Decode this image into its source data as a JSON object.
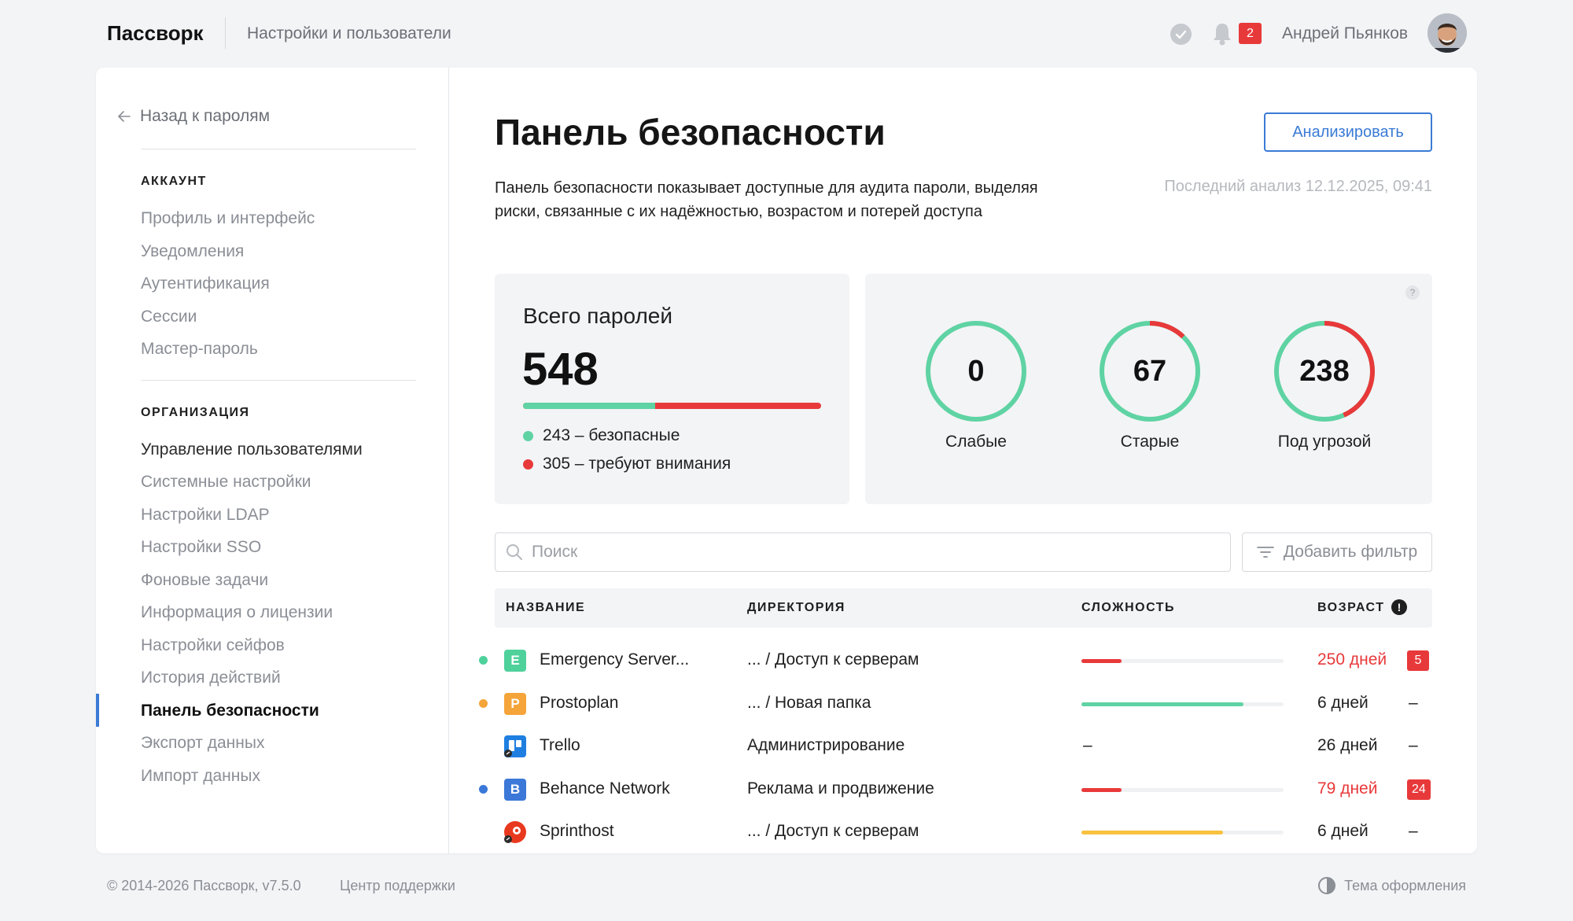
{
  "header": {
    "brand": "Пассворк",
    "breadcrumb": "Настройки и пользователи",
    "notifications_count": "2",
    "user_name": "Андрей Пьянков"
  },
  "sidebar": {
    "back_label": "Назад к паролям",
    "account_title": "АККАУНТ",
    "account_items": [
      "Профиль и интерфейс",
      "Уведомления",
      "Аутентификация",
      "Сессии",
      "Мастер-пароль"
    ],
    "org_title": "ОРГАНИЗАЦИЯ",
    "org_items": [
      "Управление пользователями",
      "Системные настройки",
      "Настройки LDAP",
      "Настройки SSO",
      "Фоновые задачи",
      "Информация о лицензии",
      "Настройки сейфов",
      "История действий",
      "Панель безопасности",
      "Экспорт данных",
      "Импорт данных"
    ],
    "active_item": "Панель безопасности"
  },
  "main": {
    "title": "Панель безопасности",
    "analyze_button": "Анализировать",
    "description": "Панель безопасности показывает доступные для аудита пароли, выделяя риски, связанные с их надёжностью, возрастом и потерей доступа",
    "last_analysis": "Последний анализ 12.12.2025, 09:41"
  },
  "stats": {
    "total_title": "Всего паролей",
    "total": "548",
    "safe_count": 243,
    "attention_count": 305,
    "safe_label": "243 – безопасные",
    "attention_label": "305 – требуют внимания",
    "help": "?",
    "rings": [
      {
        "value": "0",
        "label": "Слабые",
        "risk_fraction": 0.0
      },
      {
        "value": "67",
        "label": "Старые",
        "risk_fraction": 0.122
      },
      {
        "value": "238",
        "label": "Под угрозой",
        "risk_fraction": 0.434
      }
    ]
  },
  "search": {
    "placeholder": "Поиск"
  },
  "filter": {
    "label": "Добавить фильтр"
  },
  "table": {
    "columns": [
      "НАЗВАНИЕ",
      "ДИРЕКТОРИЯ",
      "СЛОЖНОСТЬ",
      "ВОЗРАСТ"
    ],
    "alert_header": "!",
    "rows": [
      {
        "name": "Emergency Server...",
        "icon_letter": "E",
        "icon_color": "#4fd19c",
        "dot_color": "#4fd19c",
        "directory": "... / Доступ к серверам",
        "strength": 0.2,
        "strength_color": "#e8393a",
        "age": "250 дней",
        "age_warn": true,
        "alerts": "5"
      },
      {
        "name": "Prostoplan",
        "icon_letter": "P",
        "icon_color": "#f5a43a",
        "dot_color": "#f5a43a",
        "directory": "... / Новая папка",
        "strength": 0.8,
        "strength_color": "#5fd3a3",
        "age": "6 дней",
        "age_warn": false,
        "alerts": "–"
      },
      {
        "name": "Trello",
        "icon_letter": "",
        "icon_color": "#1f7fe0",
        "dot_color": "",
        "directory": "Администрирование",
        "strength": null,
        "strength_color": "",
        "age": "26 дней",
        "age_warn": false,
        "alerts": "–"
      },
      {
        "name": "Behance Network",
        "icon_letter": "B",
        "icon_color": "#3b78d8",
        "dot_color": "#3b78d8",
        "directory": "Реклама и продвижение",
        "strength": 0.2,
        "strength_color": "#e8393a",
        "age": "79 дней",
        "age_warn": true,
        "alerts": "24"
      },
      {
        "name": "Sprinthost",
        "icon_letter": "",
        "icon_color": "#e8391f",
        "dot_color": "",
        "directory": "... / Доступ к серверам",
        "strength": 0.7,
        "strength_color": "#f7c23e",
        "age": "6 дней",
        "age_warn": false,
        "alerts": "–"
      }
    ],
    "empty_strength": "–"
  },
  "footer": {
    "copyright": "© 2014-2026 Пассворк, v7.5.0",
    "support": "Центр поддержки",
    "theme": "Тема оформления"
  },
  "colors": {
    "accent": "#3a7bd5",
    "danger": "#e8393a",
    "safe": "#5fd3a3"
  }
}
